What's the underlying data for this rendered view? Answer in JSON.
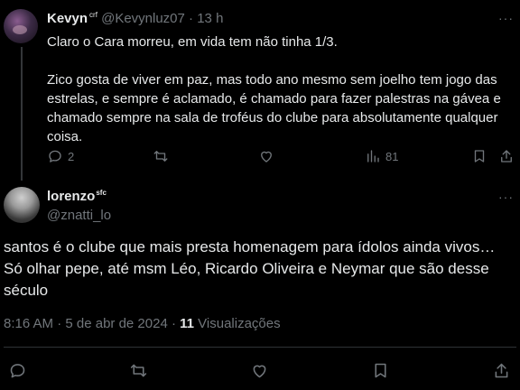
{
  "reply": {
    "author_name": "Kevyn",
    "author_badge": "crf",
    "author_handle": "@Kevynluz07",
    "separator": "·",
    "time": "13 h",
    "paragraphs": [
      "Claro o Cara morreu, em vida tem não tinha 1/3.",
      "Zico gosta de viver em paz, mas todo ano mesmo sem joelho tem jogo das estrelas, e sempre é aclamado, é chamado para fazer palestras na gávea e chamado sempre na sala de troféus do clube para absolutamente qualquer coisa."
    ],
    "reply_count": "2",
    "views_count": "81",
    "more_label": "···"
  },
  "main": {
    "author_name": "lorenzo",
    "author_badge": "sfc",
    "author_handle": "@znatti_lo",
    "more_label": "···",
    "text": "santos é o clube que mais presta homenagem para ídolos ainda vivos… Só olhar pepe, até msm Léo, Ricardo Oliveira e Neymar que são desse século",
    "timestamp": "8:16 AM · 5 de abr de 2024 ·",
    "views_count": "11",
    "views_label": "Visualizações"
  },
  "colors": {
    "background": "#000000",
    "text": "#e7e9ea",
    "muted": "#71767b",
    "divider": "#2f3336"
  }
}
